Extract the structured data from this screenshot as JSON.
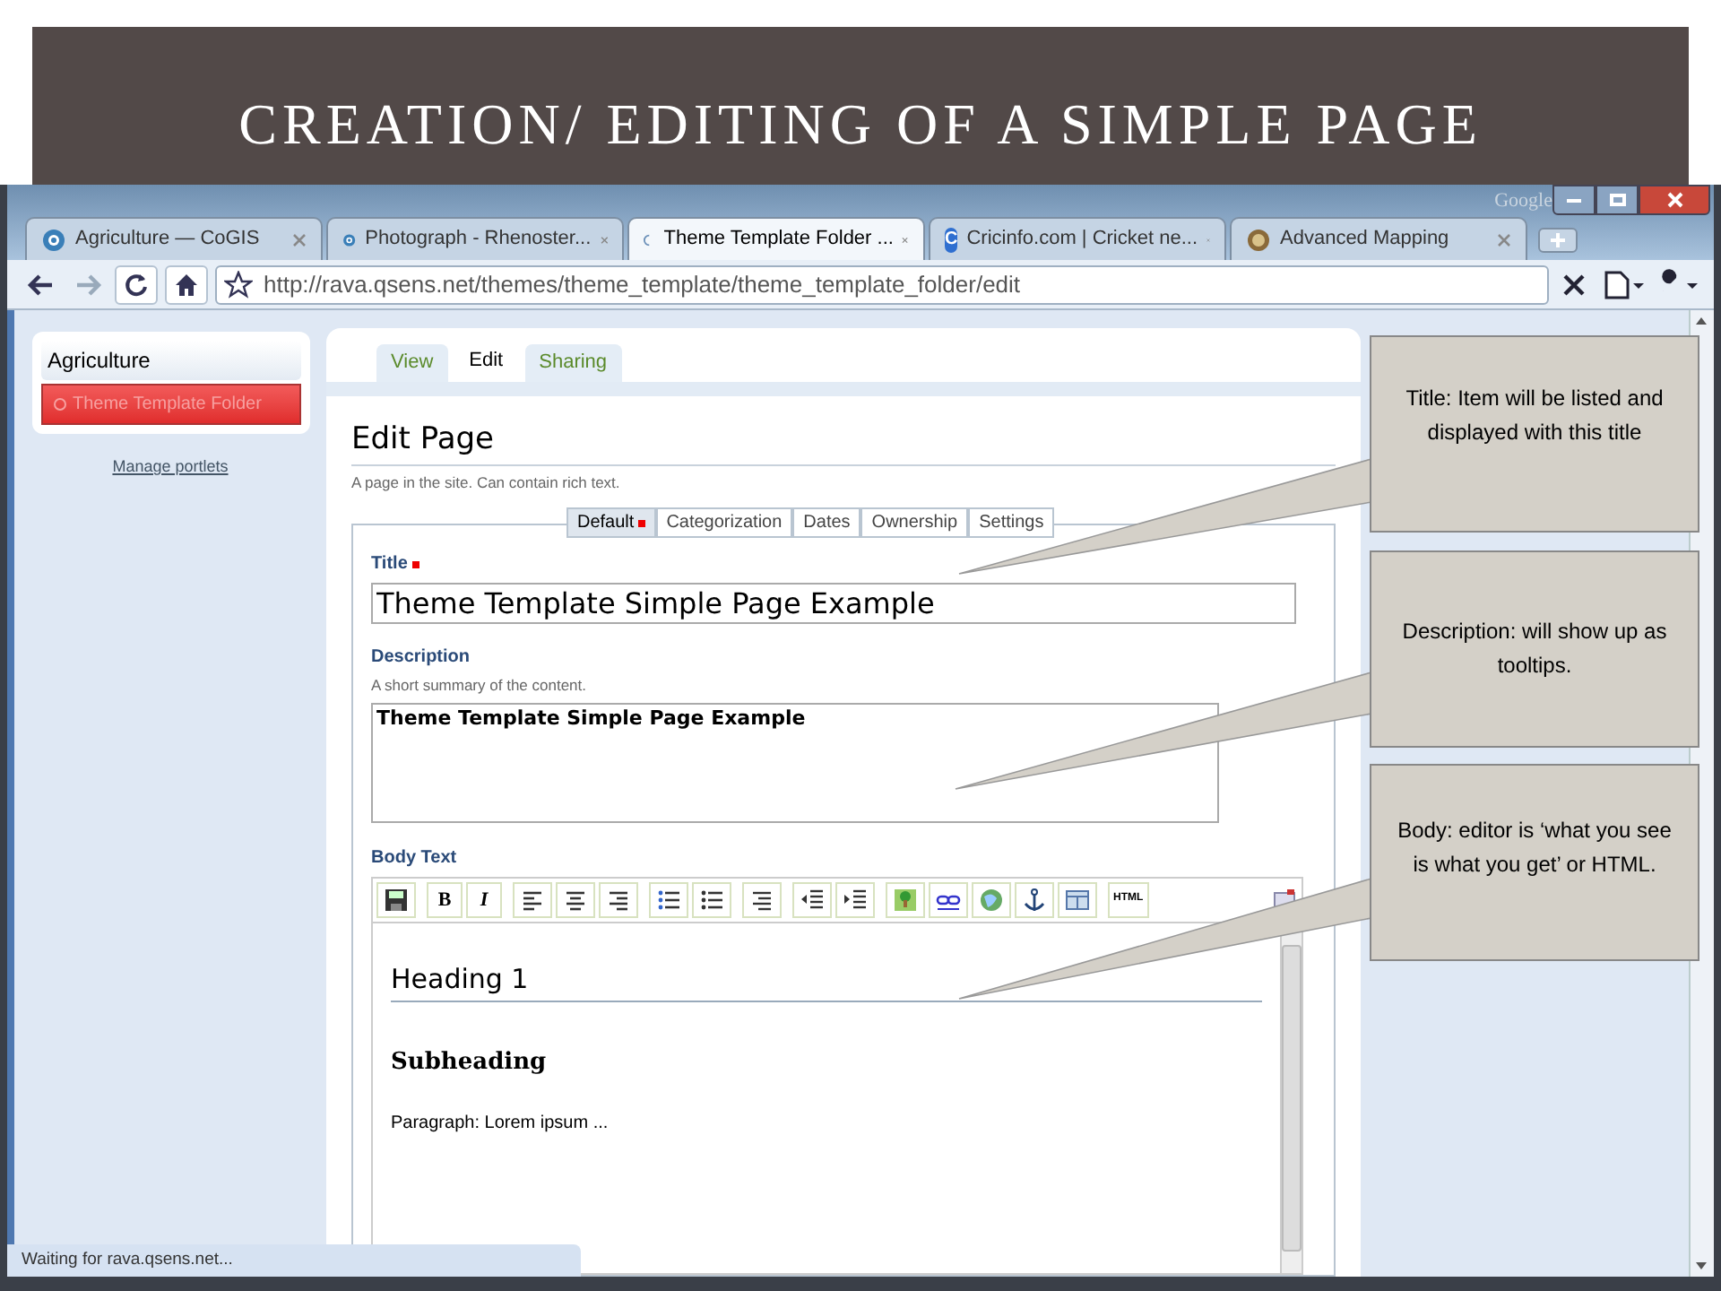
{
  "slide": {
    "title": "CREATION/ EDITING OF A SIMPLE PAGE"
  },
  "browser": {
    "brand": "Google",
    "tabs": [
      {
        "label": "Agriculture — CoGIS",
        "selected": false,
        "kind": "globe"
      },
      {
        "label": "Photograph - Rhenoster...",
        "selected": false,
        "kind": "globe"
      },
      {
        "label": "Theme Template Folder ...",
        "selected": true,
        "kind": "loading"
      },
      {
        "label": "Cricinfo.com | Cricket ne...",
        "selected": false,
        "kind": "letter",
        "icon_text": "C"
      },
      {
        "label": "Advanced Mapping",
        "selected": false,
        "kind": "map"
      }
    ],
    "url": "http://rava.qsens.net/themes/theme_template/theme_template_folder/edit",
    "status": "Waiting for rava.qsens.net..."
  },
  "portlet": {
    "header": "Agriculture",
    "items": [
      {
        "label": "Theme Template Folder",
        "selected": true
      }
    ],
    "manage_link": "Manage portlets"
  },
  "content_tabs": [
    {
      "label": "View",
      "selected": false
    },
    {
      "label": "Edit",
      "selected": true
    },
    {
      "label": "Sharing",
      "selected": false
    }
  ],
  "page": {
    "heading": "Edit Page",
    "description": "A page in the site. Can contain rich text."
  },
  "form_tabs": [
    {
      "label": "Default",
      "selected": true,
      "required": true
    },
    {
      "label": "Categorization",
      "selected": false,
      "required": false
    },
    {
      "label": "Dates",
      "selected": false,
      "required": false
    },
    {
      "label": "Ownership",
      "selected": false,
      "required": false
    },
    {
      "label": "Settings",
      "selected": false,
      "required": false
    }
  ],
  "title_field": {
    "label": "Title",
    "required": true,
    "value": "Theme Template Simple Page Example"
  },
  "description_field": {
    "label": "Description",
    "help": "A short summary of the content.",
    "value": "Theme Template Simple Page Example"
  },
  "body": {
    "label": "Body Text",
    "toolbar": [
      {
        "kind": "icon"
      },
      {
        "kind": "bold",
        "label": "B"
      },
      {
        "kind": "italic",
        "label": "I"
      },
      {
        "kind": "icon"
      },
      {
        "kind": "icon"
      },
      {
        "kind": "icon"
      },
      {
        "kind": "icon"
      },
      {
        "kind": "icon"
      },
      {
        "kind": "icon"
      },
      {
        "kind": "icon"
      },
      {
        "kind": "icon"
      },
      {
        "kind": "icon"
      },
      {
        "kind": "icon"
      },
      {
        "kind": "icon"
      },
      {
        "kind": "icon"
      },
      {
        "kind": "icon"
      },
      {
        "kind": "html",
        "label": "HTML"
      }
    ],
    "heading": "Heading 1",
    "subheading": "Subheading",
    "paragraph": "Paragraph: Lorem ipsum ..."
  },
  "callouts": [
    {
      "text": "Title: Item will be listed and displayed with this title"
    },
    {
      "text": "Description: will show up as tooltips."
    },
    {
      "text": "Body: editor is ‘what you see is what you get’ or HTML."
    }
  ]
}
